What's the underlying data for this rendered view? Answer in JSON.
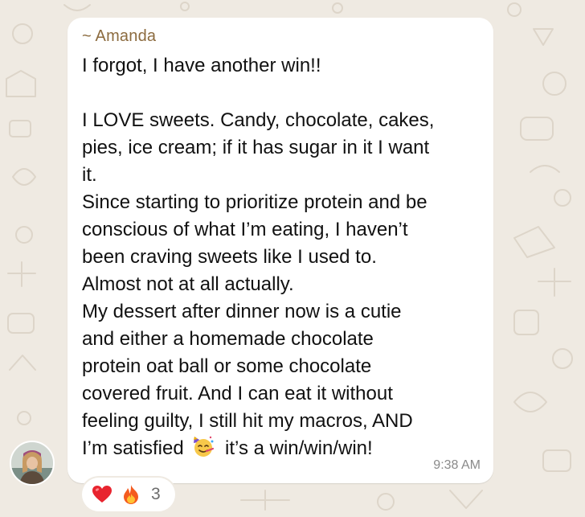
{
  "chat": {
    "sender_name": "~ Amanda",
    "message_lines": [
      "I forgot, I have another win!!",
      "",
      "I LOVE sweets. Candy, chocolate, cakes,",
      "pies, ice cream; if it has sugar in it I want",
      "it.",
      "Since starting to prioritize protein and be",
      "conscious of what I’m eating, I haven’t",
      "been craving sweets like I used to.",
      "Almost not at all actually.",
      "My dessert after dinner now is a cutie",
      "and either a homemade chocolate",
      "protein oat ball or some chocolate",
      "covered fruit. And I can eat it without",
      "feeling guilty, I still hit my macros, AND"
    ],
    "last_line_before_emoji": "I’m satisfied",
    "last_line_after_emoji": "it’s a win/win/win!",
    "inline_emoji": "partying-face-emoji",
    "timestamp": "9:38 AM",
    "reactions": {
      "icons": [
        "heart-emoji",
        "fire-emoji"
      ],
      "count": "3"
    }
  },
  "colors": {
    "background": "#efeae2",
    "bubble": "#ffffff",
    "sender_name": "#8c6b3f",
    "timestamp": "#8a8a8a"
  }
}
